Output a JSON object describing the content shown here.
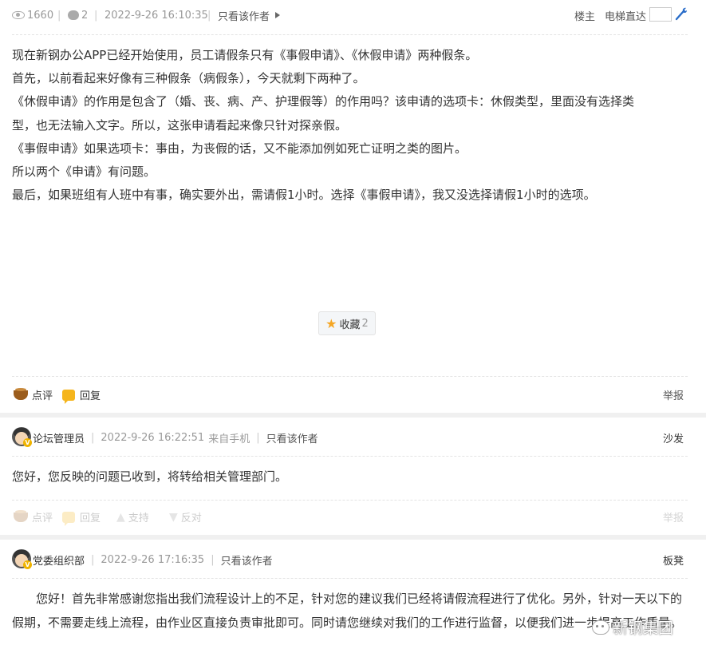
{
  "post_meta": {
    "views": "1660",
    "comments": "2",
    "datetime": "2022-9-26 16:10:35",
    "only_author": "只看该作者",
    "floor_label": "楼主",
    "jump_label": "电梯直达"
  },
  "post": {
    "lines": [
      "现在新钢办公APP已经开始使用，员工请假条只有《事假申请》、《休假申请》两种假条。",
      "首先，以前看起来好像有三种假条（病假条），今天就剩下两种了。",
      "《休假申请》的作用是包含了（婚、丧、病、产、护理假等）的作用吗？该申请的选项卡：休假类型，里面没有选择类",
      "型，也无法输入文字。所以，这张申请看起来像只针对探亲假。",
      "《事假申请》如果选项卡：事由，为丧假的话，又不能添加例如死亡证明之类的图片。",
      "所以两个《申请》有问题。",
      "最后，如果班组有人班中有事，确实要外出，需请假1小时。选择《事假申请》，我又没选择请假1小时的选项。"
    ],
    "favorite_label": "收藏",
    "favorite_count": "2"
  },
  "actions": {
    "comment": "点评",
    "reply": "回复",
    "support": "支持",
    "oppose": "反对",
    "report": "举报"
  },
  "replies": [
    {
      "author": "论坛管理员",
      "datetime": "2022-9-26 16:22:51",
      "device": "来自手机",
      "only_author": "只看该作者",
      "floor": "沙发",
      "content": "您好，您反映的问题已收到，将转给相关管理部门。"
    },
    {
      "author": "党委组织部",
      "datetime": "2022-9-26 17:16:35",
      "only_author": "只看该作者",
      "floor": "板凳",
      "content": "您好！首先非常感谢您指出我们流程设计上的不足，针对您的建议我们已经将请假流程进行了优化。另外，针对一天以下的假期，不需要走线上流程，由作业区直接负责审批即可。同时请您继续对我们的工作进行监督，以便我们进一步提高工作质量。"
    }
  ],
  "watermark": "新钢集团"
}
